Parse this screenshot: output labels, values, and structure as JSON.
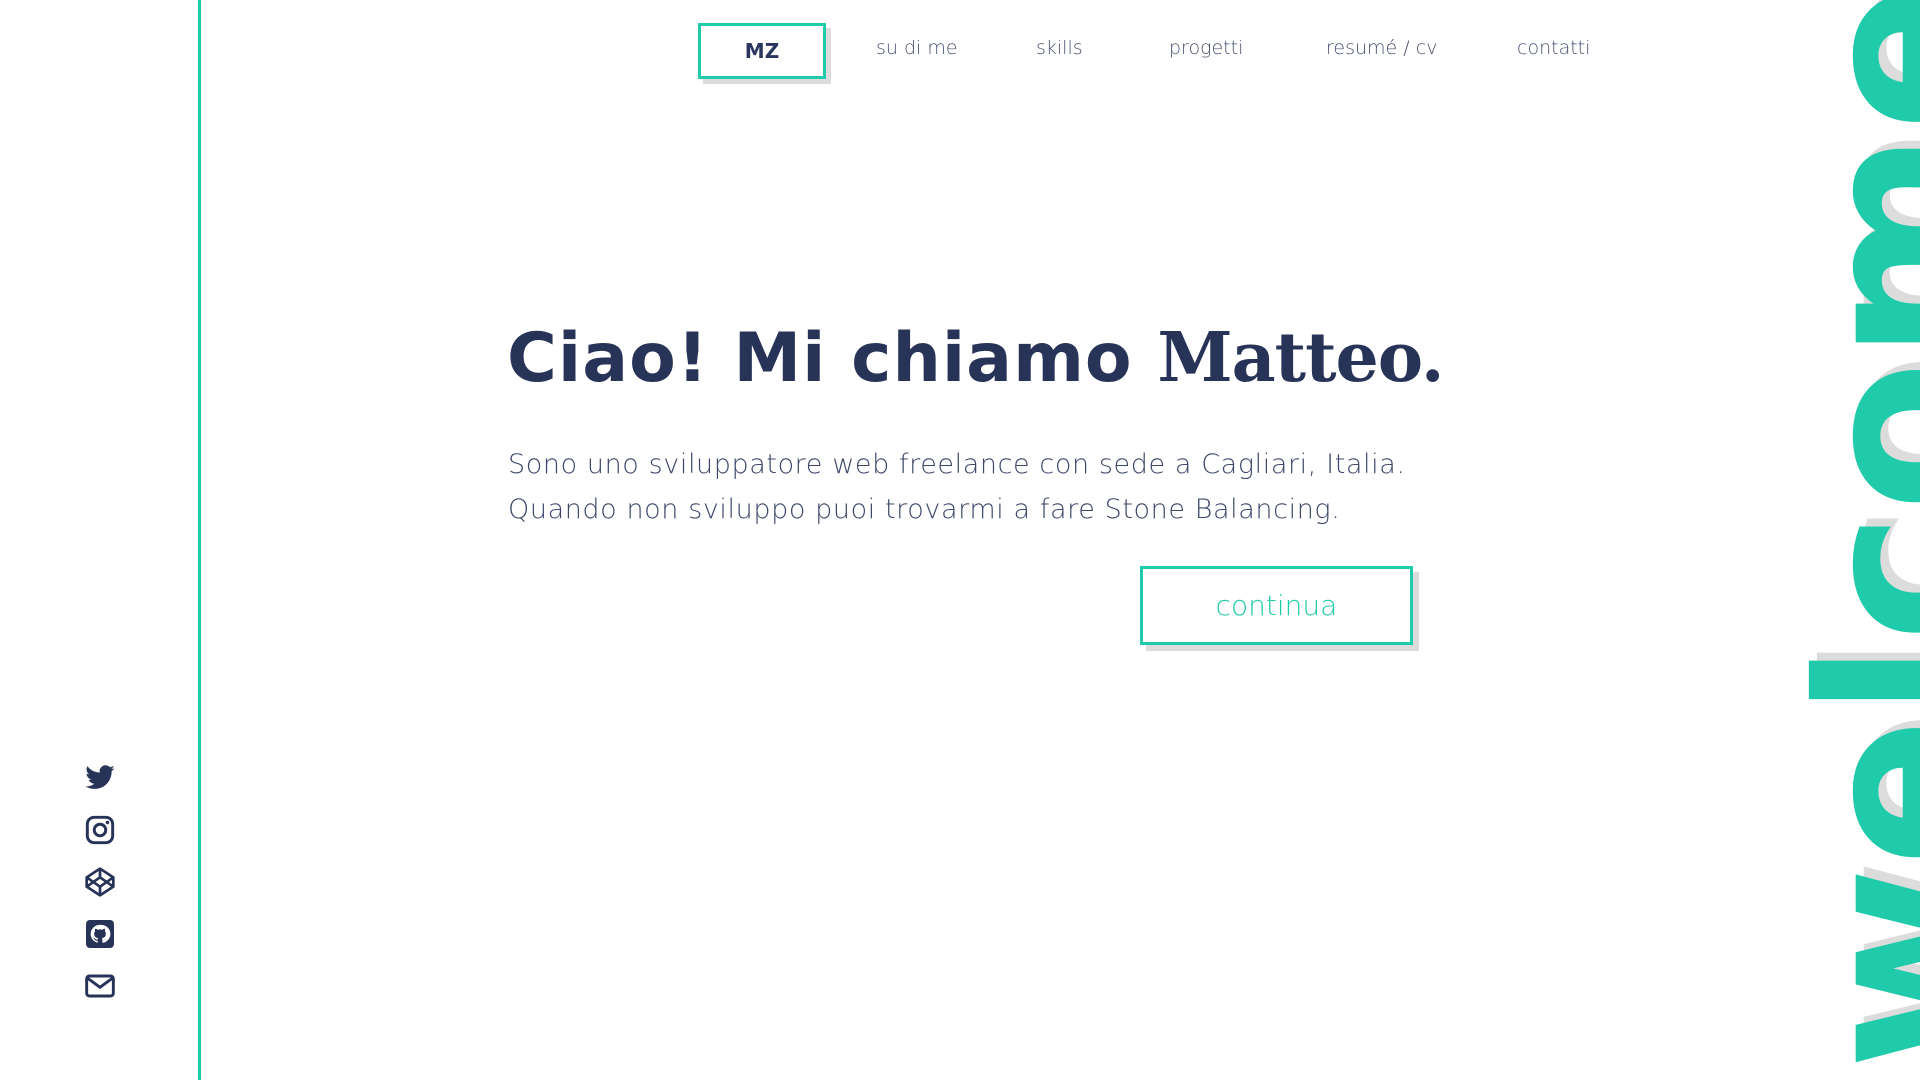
{
  "nav": {
    "brand": "MZ",
    "links": [
      {
        "label": "su di me"
      },
      {
        "label": "skills"
      },
      {
        "label": "progetti"
      },
      {
        "label": "resumé / cv"
      },
      {
        "label": "contatti"
      }
    ]
  },
  "hero": {
    "title_prefix": "Ciao! Mi chiamo",
    "title_name": "Matteo.",
    "line1": "Sono uno sviluppatore web freelance con sede a Cagliari, Italia.",
    "line2": "Quando non sviluppo puoi trovarmi a fare Stone Balancing.",
    "cta_label": "continua"
  },
  "side_text": "welcome",
  "social": [
    {
      "icon": "twitter-icon"
    },
    {
      "icon": "instagram-icon"
    },
    {
      "icon": "codepen-icon"
    },
    {
      "icon": "github-icon"
    },
    {
      "icon": "email-icon"
    }
  ],
  "colors": {
    "accent": "#1fcbaa",
    "navy": "#283358",
    "shadow": "#dcdcdc"
  }
}
